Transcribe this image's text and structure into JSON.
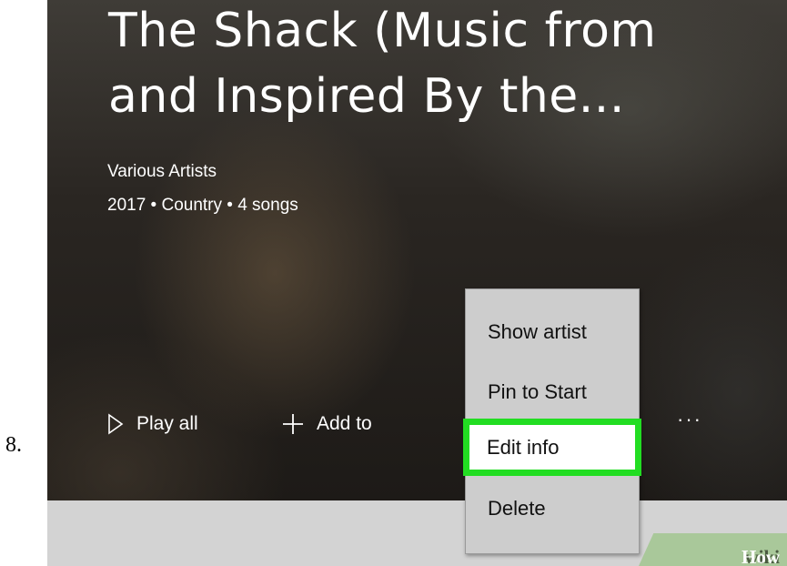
{
  "step": {
    "number": "8."
  },
  "album": {
    "title_line1": "The Shack (Music from",
    "title_line2": "and Inspired By the...",
    "artist": "Various Artists",
    "meta": "2017 • Country • 4 songs"
  },
  "actions": {
    "play_all": "Play all",
    "add_to": "Add to",
    "more": "···"
  },
  "context_menu": {
    "items": [
      {
        "label": "Show artist"
      },
      {
        "label": "Pin to Start"
      },
      {
        "label": "Edit info",
        "highlighted": true
      },
      {
        "label": "Delete"
      }
    ]
  },
  "watermark": {
    "part1": "wiki",
    "part2": "How"
  },
  "colors": {
    "highlight": "#22dd22",
    "menu_bg": "#cdcdcd"
  }
}
